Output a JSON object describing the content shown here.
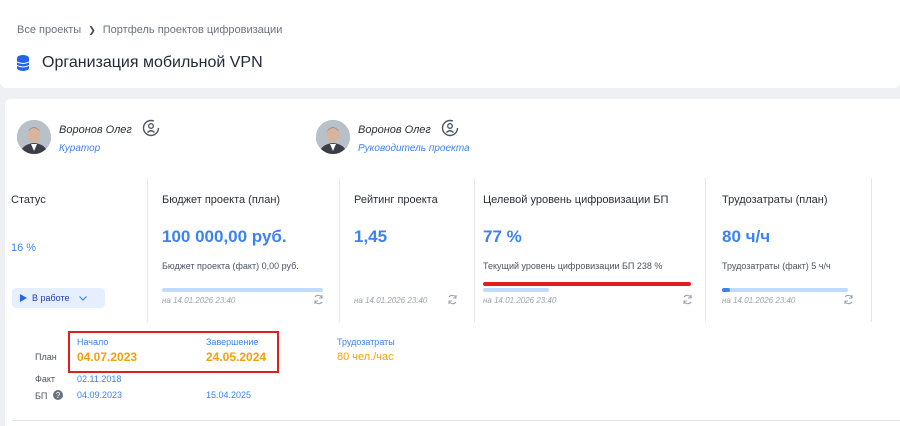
{
  "breadcrumb": {
    "root": "Все проекты",
    "current": "Портфель проектов цифровизации"
  },
  "page": {
    "title": "Организация мобильной VPN"
  },
  "people": [
    {
      "name": "Воронов Олег",
      "role": "Куратор"
    },
    {
      "name": "Воронов Олег",
      "role": "Руководитель проекта"
    }
  ],
  "metrics": {
    "status": {
      "title": "Статус",
      "percent": "16 %",
      "state": "В работе"
    },
    "budget": {
      "title": "Бюджет проекта (план)",
      "value": "100 000,00 руб.",
      "sub": "Бюджет проекта (факт) 0,00 руб.",
      "timestamp": "на 14.01.2026 23:40",
      "progress": 0
    },
    "rating": {
      "title": "Рейтинг проекта",
      "value": "1,45",
      "timestamp": "на 14.01.2026 23:40"
    },
    "digital": {
      "title": "Целевой уровень цифровизации БП",
      "value": "77 %",
      "sub": "Текущий уровень цифровизации БП 238 %",
      "timestamp": "на 14.01.2026 23:40",
      "progress": 0
    },
    "labor": {
      "title": "Трудозатраты (план)",
      "value": "80 ч/ч",
      "sub": "Трудозатраты (факт) 5 ч/ч",
      "timestamp": "на 14.01.2026 23:40",
      "progress": 0.06
    }
  },
  "dates": {
    "headers": {
      "start": "Начало",
      "end": "Завершение",
      "labor": "Трудозатраты"
    },
    "plan": {
      "label": "План",
      "start": "04.07.2023",
      "end": "24.05.2024",
      "labor": "80 чел./час"
    },
    "fact": {
      "label": "Факт",
      "start": "02.11.2018"
    },
    "bp": {
      "label": "БП",
      "start": "04.09.2023",
      "end": "15.04.2025"
    }
  },
  "colors": {
    "accent": "#3b82f6",
    "warning": "#f59e0b",
    "highlight": "#e11d1d"
  }
}
